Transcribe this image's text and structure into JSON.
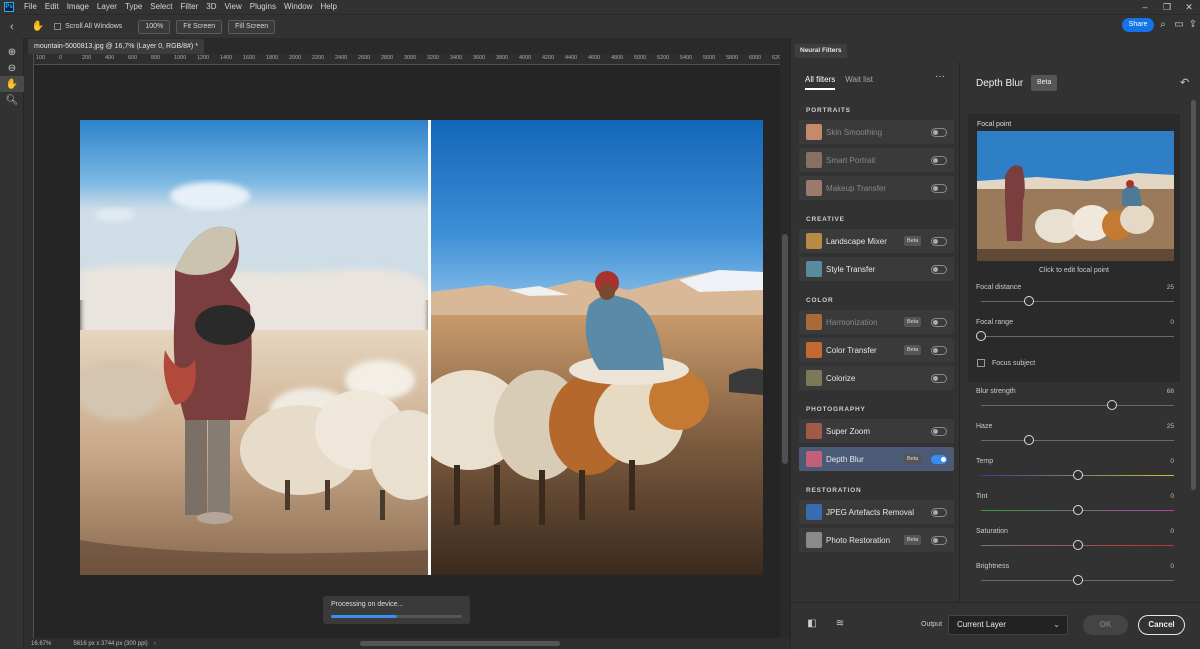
{
  "menubar": {
    "logo": "Ps",
    "items": [
      "File",
      "Edit",
      "Image",
      "Layer",
      "Type",
      "Select",
      "Filter",
      "3D",
      "View",
      "Plugins",
      "Window",
      "Help"
    ],
    "window_controls": [
      "–",
      "❐",
      "✕"
    ]
  },
  "options": {
    "scroll_all_windows": "Scroll All Windows",
    "zoom_100": "100%",
    "fit_screen": "Fit Screen",
    "fill_screen": "Fill Screen",
    "share": "Share"
  },
  "document": {
    "tab_title": "mountain-5000813.jpg @ 16,7% (Layer 0, RGB/8#) *",
    "ruler_ticks": [
      "100",
      "0",
      "200",
      "400",
      "600",
      "800",
      "1000",
      "1200",
      "1400",
      "1600",
      "1800",
      "2000",
      "2200",
      "2400",
      "2600",
      "2800",
      "3000",
      "3200",
      "3400",
      "3600",
      "3800",
      "4000",
      "4200",
      "4400",
      "4600",
      "4800",
      "5000",
      "5200",
      "5400",
      "5600",
      "5800",
      "6000",
      "6200"
    ],
    "zoom": "16.67%",
    "size_info": "5616 px x 3744 px (300 ppi)",
    "processing_label": "Processing on device...",
    "processing_progress": 0.5
  },
  "neural_filters": {
    "panel_tab": "Neural Filters",
    "tabs": [
      "All filters",
      "Wait list"
    ],
    "sections": [
      {
        "title": "PORTRAITS",
        "items": [
          {
            "name": "Skin Smoothing",
            "beta": "",
            "on": false,
            "dim": true
          },
          {
            "name": "Smart Portrait",
            "beta": "",
            "on": false,
            "dim": true
          },
          {
            "name": "Makeup Transfer",
            "beta": "",
            "on": false,
            "dim": true
          }
        ]
      },
      {
        "title": "CREATIVE",
        "items": [
          {
            "name": "Landscape Mixer",
            "beta": "Beta",
            "on": false,
            "dim": false
          },
          {
            "name": "Style Transfer",
            "beta": "",
            "on": false,
            "dim": false
          }
        ]
      },
      {
        "title": "COLOR",
        "items": [
          {
            "name": "Harmonization",
            "beta": "Beta",
            "on": false,
            "dim": true
          },
          {
            "name": "Color Transfer",
            "beta": "Beta",
            "on": false,
            "dim": false
          },
          {
            "name": "Colorize",
            "beta": "",
            "on": false,
            "dim": false
          }
        ]
      },
      {
        "title": "PHOTOGRAPHY",
        "items": [
          {
            "name": "Super Zoom",
            "beta": "",
            "on": false,
            "dim": false
          },
          {
            "name": "Depth Blur",
            "beta": "Beta",
            "on": true,
            "dim": false,
            "selected": true
          }
        ]
      },
      {
        "title": "RESTORATION",
        "items": [
          {
            "name": "JPEG Artefacts Removal",
            "beta": "",
            "on": false,
            "dim": false
          },
          {
            "name": "Photo Restoration",
            "beta": "Beta",
            "on": false,
            "dim": false
          }
        ]
      }
    ]
  },
  "depth_blur": {
    "title": "Depth Blur",
    "beta": "Beta",
    "focal_point_label": "Focal point",
    "focal_caption": "Click to edit focal point",
    "focus_subject": "Focus subject",
    "params": [
      {
        "label": "Focal distance",
        "value": "25",
        "level": 0.25
      },
      {
        "label": "Focal range",
        "value": "0",
        "level": 0
      },
      {
        "label": "Blur strength",
        "value": "68",
        "level": 0.68
      },
      {
        "label": "Haze",
        "value": "25",
        "level": 0.25
      },
      {
        "label": "Temp",
        "value": "0",
        "level": 0.5
      },
      {
        "label": "Tint",
        "value": "0",
        "level": 0.5
      },
      {
        "label": "Saturation",
        "value": "0",
        "level": 0.5
      },
      {
        "label": "Brightness",
        "value": "0",
        "level": 0.5
      }
    ]
  },
  "bottom": {
    "output_label": "Output",
    "output_value": "Current Layer",
    "ok": "OK",
    "cancel": "Cancel"
  },
  "colors": {
    "accent": "#378ef0",
    "share": "#1473e6",
    "selected_row": "#4b5b76"
  }
}
